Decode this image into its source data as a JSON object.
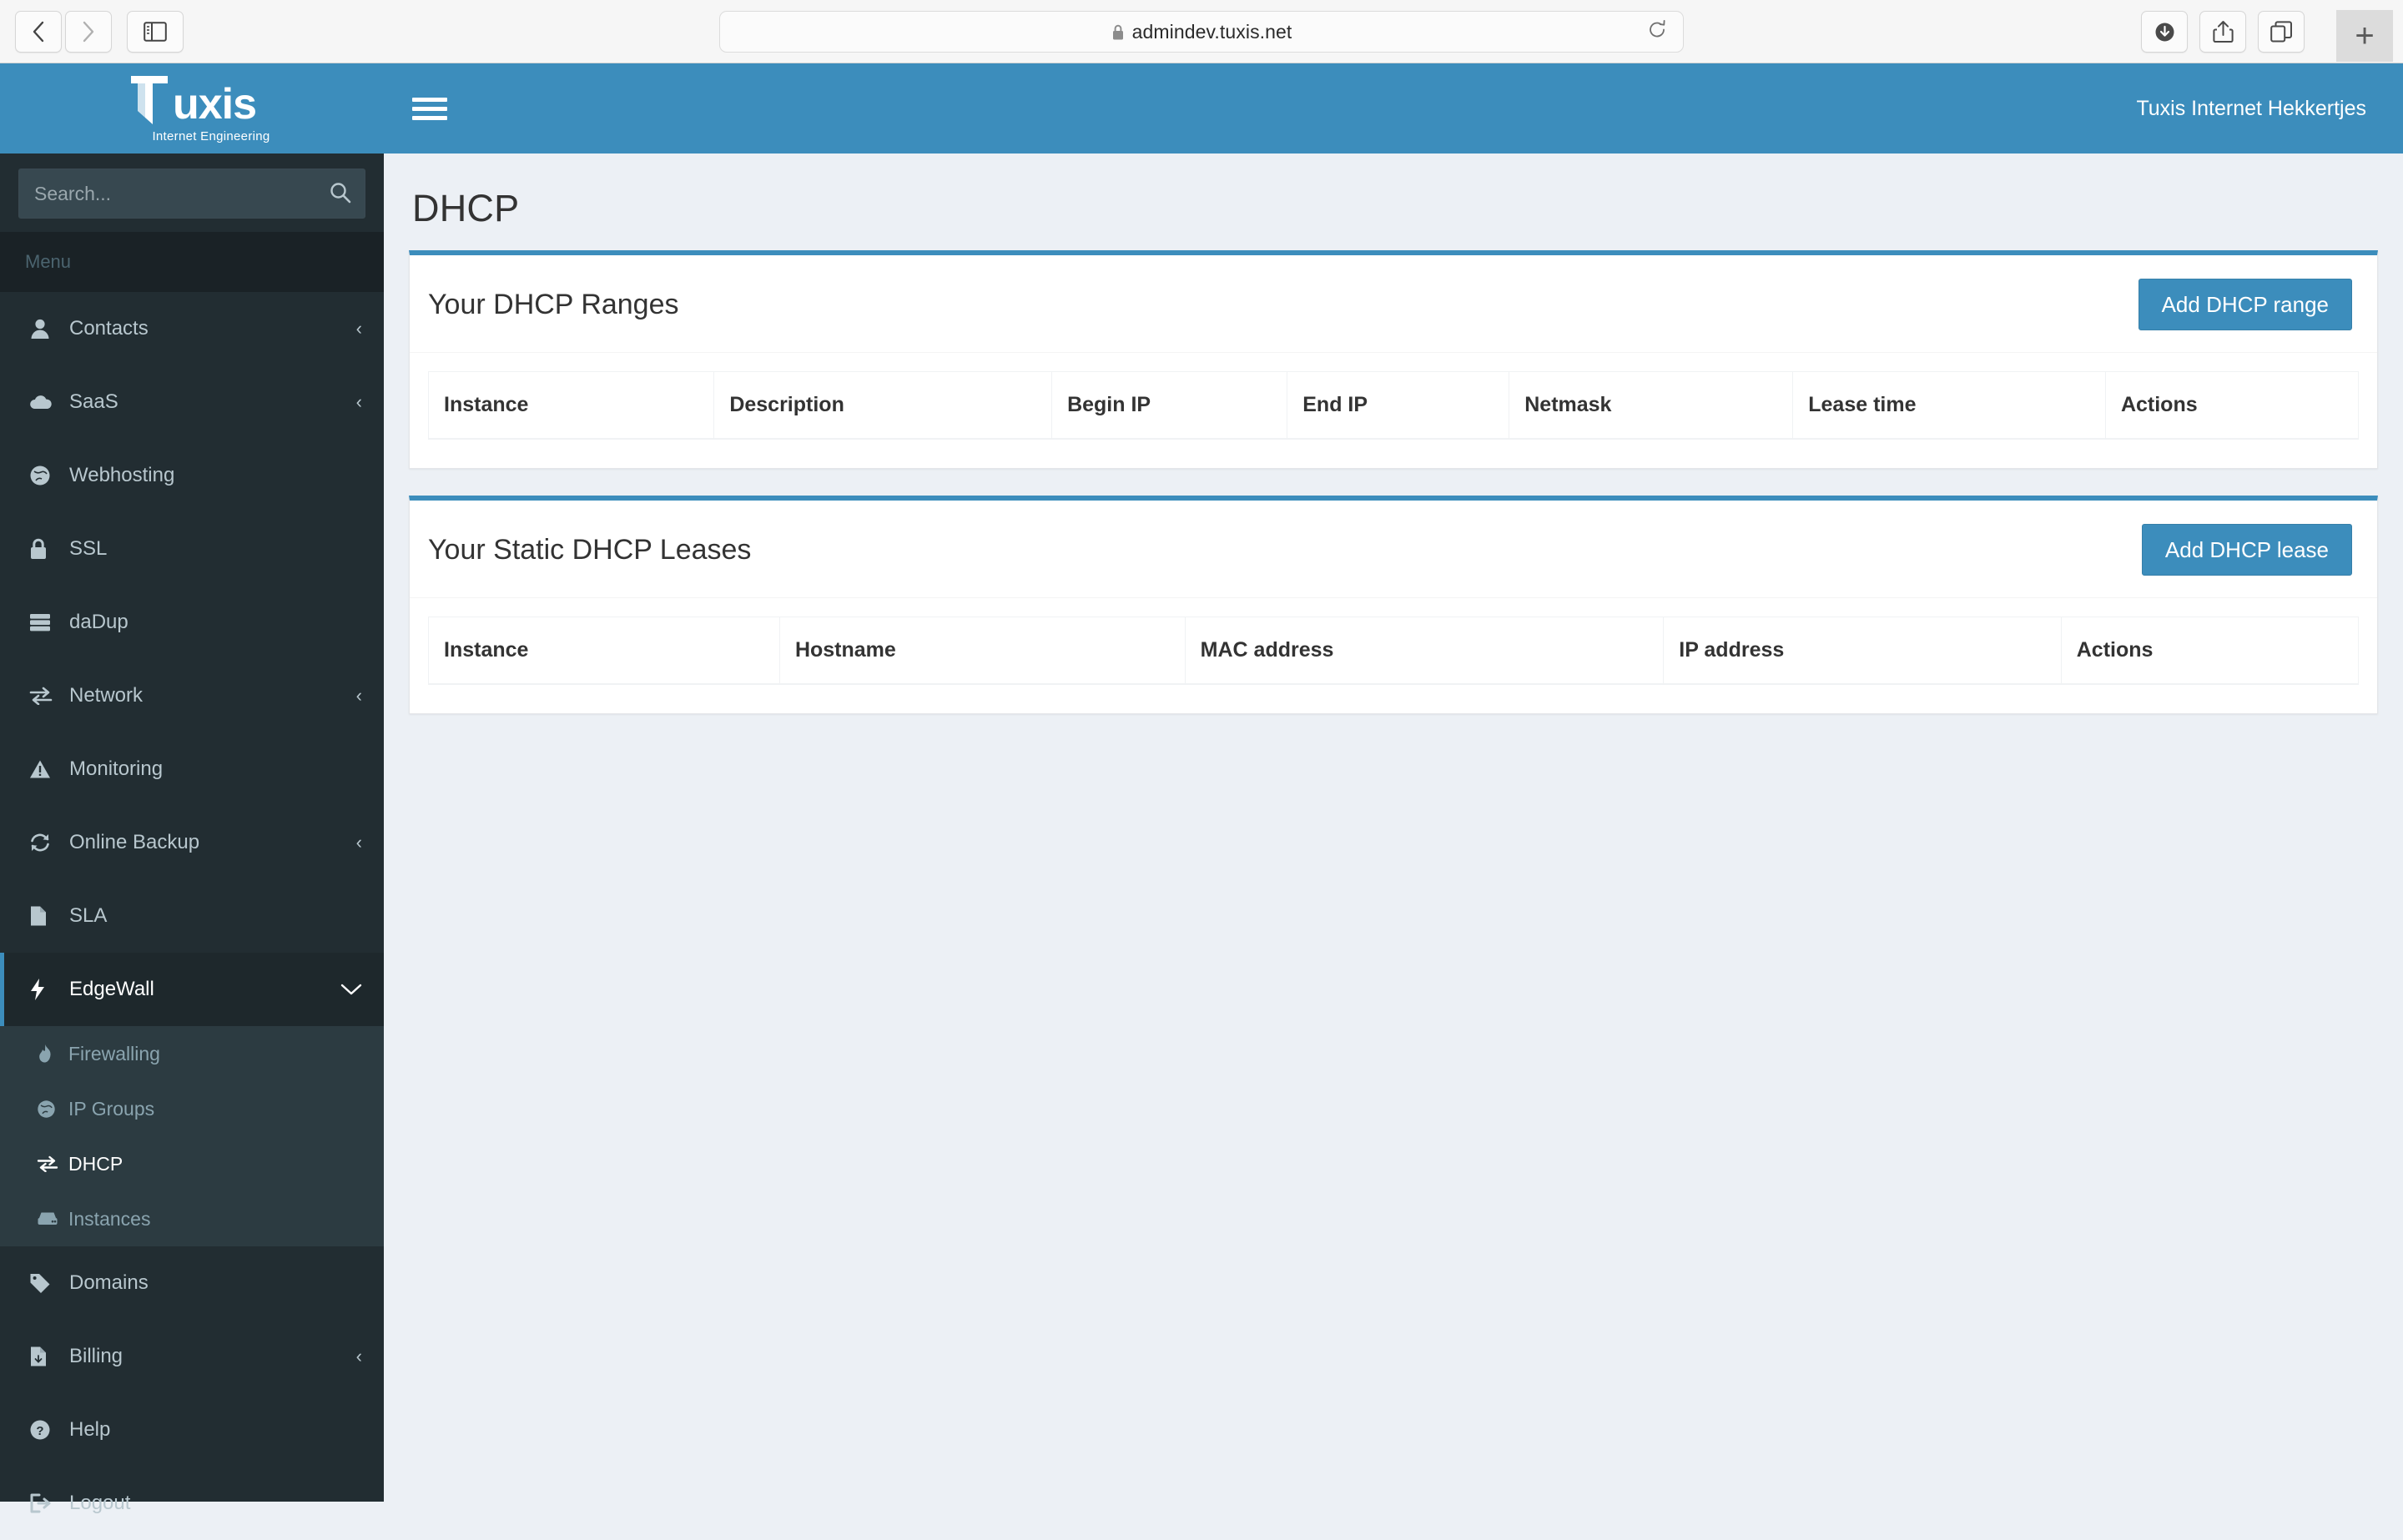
{
  "browser": {
    "back_icon": "chevron-left-icon",
    "forward_icon": "chevron-right-icon",
    "sidebar_icon": "sidebar-panel-icon",
    "url": "admindev.tuxis.net",
    "lock_icon": "lock-icon",
    "reload_icon": "reload-icon",
    "downloads_icon": "download-icon",
    "share_icon": "share-icon",
    "tabs_icon": "tab-overview-icon",
    "new_tab_label": "+"
  },
  "sidebar": {
    "logo": {
      "word": "uxis",
      "tagline": "Internet Engineering"
    },
    "search": {
      "placeholder": "Search...",
      "value": "",
      "icon": "search-icon"
    },
    "menu_header": "Menu",
    "items": [
      {
        "label": "Contacts",
        "icon": "user-icon",
        "caret": "‹",
        "active": false
      },
      {
        "label": "SaaS",
        "icon": "cloud-icon",
        "caret": "‹",
        "active": false
      },
      {
        "label": "Webhosting",
        "icon": "globe-icon",
        "caret": "",
        "active": false
      },
      {
        "label": "SSL",
        "icon": "lock-icon",
        "caret": "",
        "active": false
      },
      {
        "label": "daDup",
        "icon": "server-icon",
        "caret": "",
        "active": false
      },
      {
        "label": "Network",
        "icon": "exchange-icon",
        "caret": "‹",
        "active": false
      },
      {
        "label": "Monitoring",
        "icon": "warning-icon",
        "caret": "",
        "active": false
      },
      {
        "label": "Online Backup",
        "icon": "refresh-icon",
        "caret": "‹",
        "active": false
      },
      {
        "label": "SLA",
        "icon": "file-icon",
        "caret": "",
        "active": false
      },
      {
        "label": "EdgeWall",
        "icon": "bolt-icon",
        "caret": "∨",
        "active": true
      },
      {
        "label": "Domains",
        "icon": "tag-icon",
        "caret": "",
        "active": false
      },
      {
        "label": "Billing",
        "icon": "file-invoice-icon",
        "caret": "‹",
        "active": false
      },
      {
        "label": "Help",
        "icon": "question-icon",
        "caret": "",
        "active": false
      },
      {
        "label": "Logout",
        "icon": "sign-out-icon",
        "caret": "",
        "active": false
      }
    ],
    "submenu": [
      {
        "label": "Firewalling",
        "icon": "fire-icon",
        "active": false
      },
      {
        "label": "IP Groups",
        "icon": "globe-icon",
        "active": false
      },
      {
        "label": "DHCP",
        "icon": "exchange-icon",
        "active": true
      },
      {
        "label": "Instances",
        "icon": "hdd-icon",
        "active": false
      }
    ]
  },
  "topbar": {
    "menu_toggle_icon": "hamburger-icon",
    "user_name": "Tuxis Internet Hekkertjes"
  },
  "page": {
    "title": "DHCP"
  },
  "panels": [
    {
      "title": "Your DHCP Ranges",
      "button": "Add DHCP range",
      "columns": [
        "Instance",
        "Description",
        "Begin IP",
        "End IP",
        "Netmask",
        "Lease time",
        "Actions"
      ],
      "rows": []
    },
    {
      "title": "Your Static DHCP Leases",
      "button": "Add DHCP lease",
      "columns": [
        "Instance",
        "Hostname",
        "MAC address",
        "IP address",
        "Actions"
      ],
      "rows": []
    }
  ],
  "colors": {
    "brand_blue": "#3C8DBC",
    "sidebar_dark": "#222D32",
    "sidebar_submenu": "#2C3B41",
    "content_bg": "#ECF0F5",
    "active_item": "#1E282C"
  }
}
